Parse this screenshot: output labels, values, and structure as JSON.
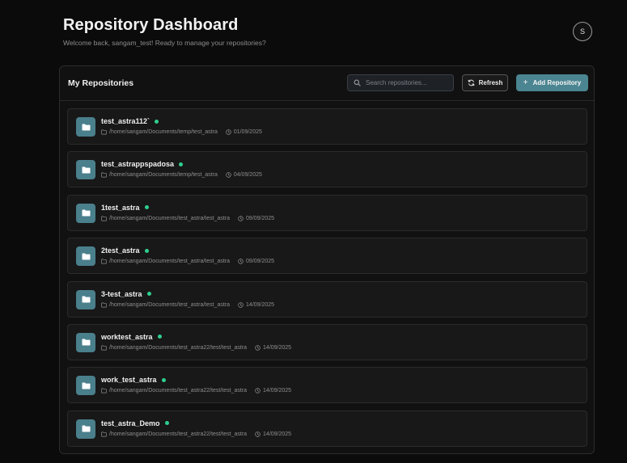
{
  "header": {
    "title": "Repository Dashboard",
    "subtitle": "Welcome back, sangam_test! Ready to manage your repositories?",
    "avatar_initial": "S"
  },
  "panel": {
    "title": "My Repositories",
    "search_placeholder": "Search repositories...",
    "refresh_label": "Refresh",
    "add_label": "Add Repository",
    "add_icon": "+"
  },
  "colors": {
    "accent": "#4b8591",
    "status_dot": "#2fcf8f",
    "background": "#0b0b0b"
  },
  "repositories": [
    {
      "name": "test_astra112`",
      "path": "/home/sangam/Documents/temp/test_astra",
      "date": "01/09/2025",
      "status": "active"
    },
    {
      "name": "test_astrappspadosa",
      "path": "/home/sangam/Documents/temp/test_astra",
      "date": "04/09/2025",
      "status": "active"
    },
    {
      "name": "1test_astra",
      "path": "/home/sangam/Documents/test_astra/test_astra",
      "date": "09/09/2025",
      "status": "active"
    },
    {
      "name": "2test_astra",
      "path": "/home/sangam/Documents/test_astra/test_astra",
      "date": "09/09/2025",
      "status": "active"
    },
    {
      "name": "3-test_astra",
      "path": "/home/sangam/Documents/test_astra/test_astra",
      "date": "14/09/2025",
      "status": "active"
    },
    {
      "name": "worktest_astra",
      "path": "/home/sangam/Documents/test_astra22/test/test_astra",
      "date": "14/09/2025",
      "status": "active"
    },
    {
      "name": "work_test_astra",
      "path": "/home/sangam/Documents/test_astra22/test/test_astra",
      "date": "14/09/2025",
      "status": "active"
    },
    {
      "name": "test_astra_Demo",
      "path": "/home/sangam/Documents/test_astra22/test/test_astra",
      "date": "14/09/2025",
      "status": "active"
    }
  ]
}
